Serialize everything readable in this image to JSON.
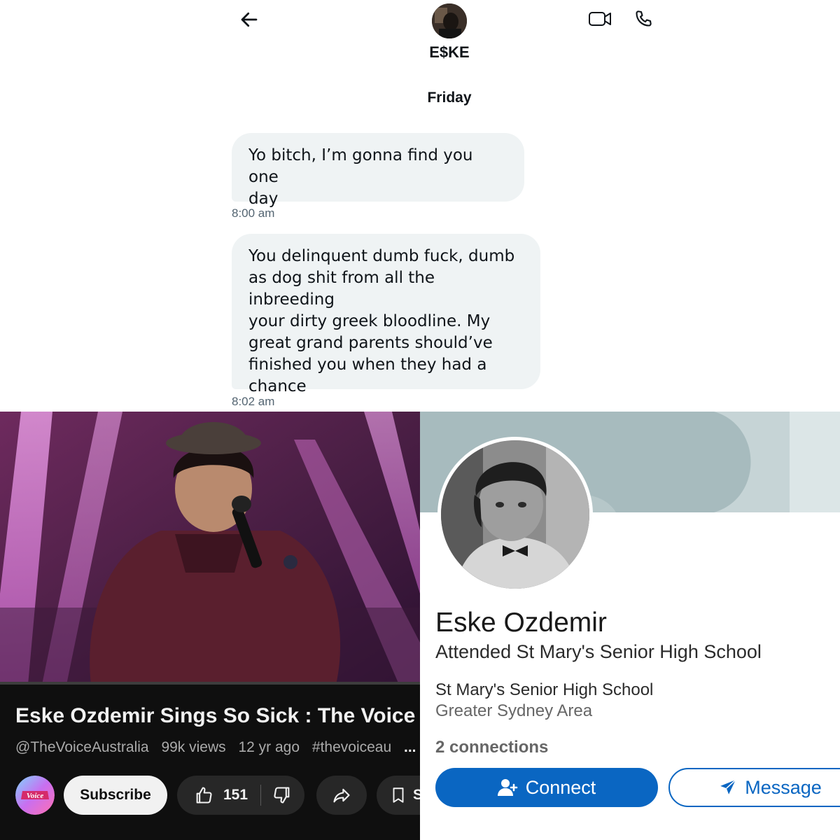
{
  "dm": {
    "contact_name": "E$KE",
    "day_label": "Friday",
    "messages": [
      {
        "lines": [
          "Yo bitch, I’m gonna find you one",
          "day"
        ],
        "time": "8:00 am"
      },
      {
        "lines": [
          "You delinquent dumb fuck, dumb",
          "as dog shit from all the inbreeding",
          "your dirty greek bloodline. My",
          "great grand parents should’ve",
          "finished you when they had a",
          "chance"
        ],
        "time": "8:02 am"
      }
    ],
    "icons": {
      "back": "arrow-left-icon",
      "video": "video-camera-icon",
      "call": "phone-icon"
    }
  },
  "video": {
    "title": "Eske Ozdemir Sings So Sick : The Voice",
    "channel": "@TheVoiceAustralia",
    "views": "99k views",
    "age": "12 yr ago",
    "hashtag": "#thevoiceau",
    "more": "...",
    "subscribe_label": "Subscribe",
    "like_count": "151",
    "save_label": "S",
    "logo_text": "Voice"
  },
  "profile": {
    "name": "Eske Ozdemir",
    "headline": "Attended St Mary's Senior High School",
    "school": "St Mary's Senior High School",
    "location": "Greater Sydney Area",
    "connections": "2 connections",
    "connect_label": "Connect",
    "message_label": "Message",
    "accent_color": "#0a66c2"
  }
}
